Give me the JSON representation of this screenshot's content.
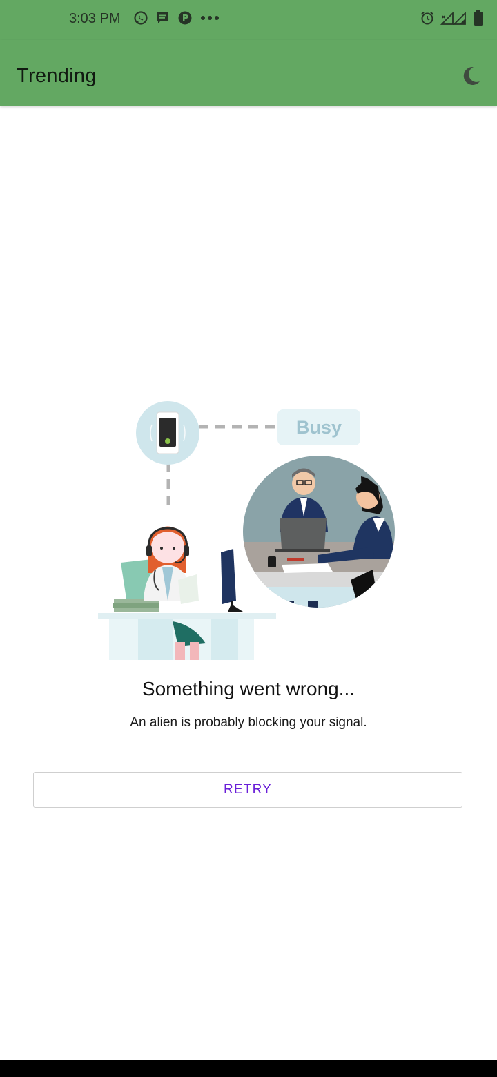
{
  "status_bar": {
    "time": "3:03 PM",
    "left_icons": [
      "whatsapp-icon",
      "message-icon",
      "app-badge-icon",
      "more-dots-icon"
    ],
    "right_icons": [
      "alarm-icon",
      "signal-icon",
      "signal-icon",
      "battery-icon"
    ]
  },
  "app_bar": {
    "title": "Trending",
    "action_icon": "moon-icon",
    "background": "#63a862"
  },
  "illustration": {
    "busy_label": "Busy"
  },
  "error": {
    "title": "Something went wrong...",
    "subtitle": "An alien is probably blocking your signal."
  },
  "retry": {
    "label": "RETRY",
    "color": "#6a1fd8"
  }
}
